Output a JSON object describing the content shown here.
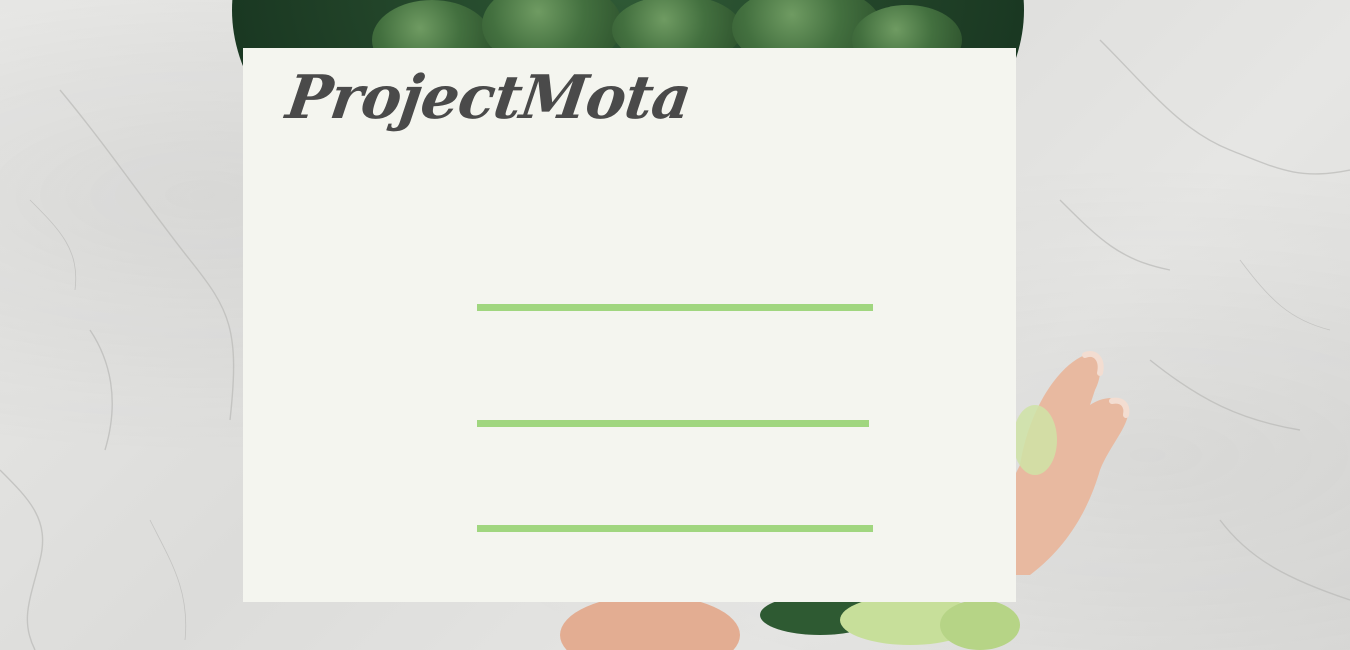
{
  "brand": {
    "name": "ProjectMota"
  },
  "colors": {
    "card_background": "#f4f5ef",
    "brand_text": "#4a4a4a",
    "accent_line": "#a0d67f",
    "marble": "#e2e2e0"
  },
  "decorations": {
    "lines": [
      "accent-line",
      "accent-line",
      "accent-line"
    ]
  }
}
